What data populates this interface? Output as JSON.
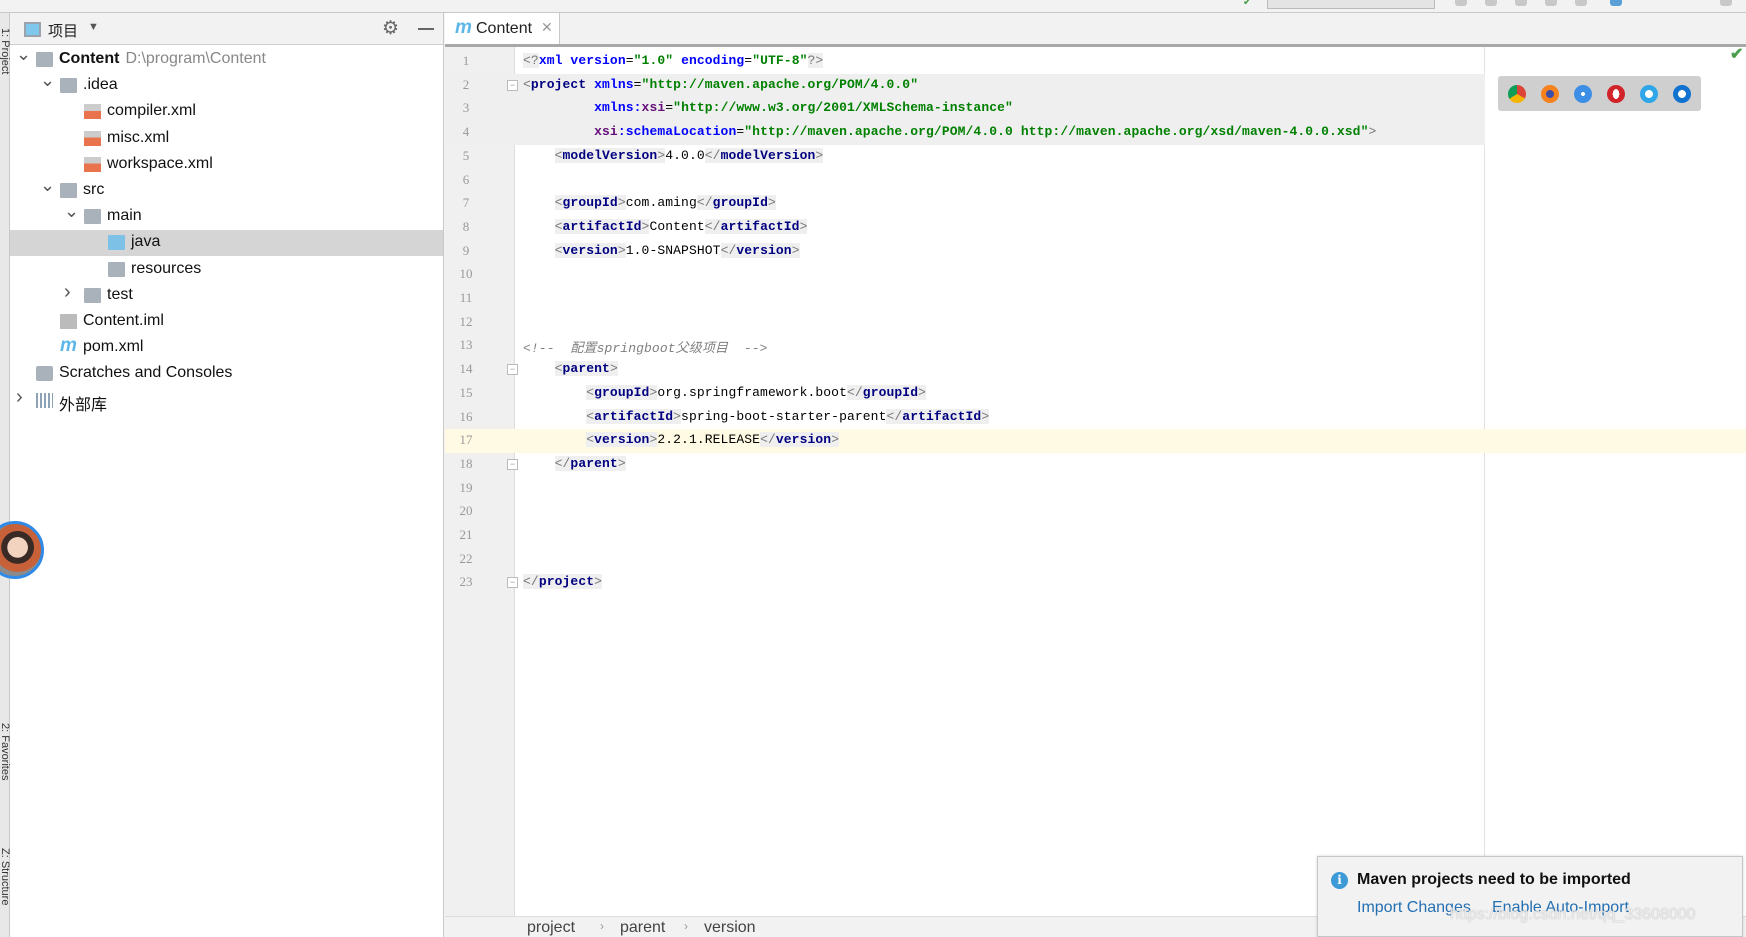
{
  "project_panel": {
    "title": "项目",
    "tree": [
      {
        "label": "Content",
        "path": "D:\\program\\Content",
        "depth": 0,
        "arrow": "down",
        "icon": "module-folder-icon",
        "bold": true
      },
      {
        "label": ".idea",
        "depth": 1,
        "arrow": "down",
        "icon": "folder-icon"
      },
      {
        "label": "compiler.xml",
        "depth": 2,
        "icon": "xml-file-icon"
      },
      {
        "label": "misc.xml",
        "depth": 2,
        "icon": "xml-file-icon"
      },
      {
        "label": "workspace.xml",
        "depth": 2,
        "icon": "xml-file-icon"
      },
      {
        "label": "src",
        "depth": 1,
        "arrow": "down",
        "icon": "folder-icon"
      },
      {
        "label": "main",
        "depth": 2,
        "arrow": "down",
        "icon": "folder-icon"
      },
      {
        "label": "java",
        "depth": 3,
        "icon": "source-folder-icon",
        "selected": true
      },
      {
        "label": "resources",
        "depth": 3,
        "icon": "resources-folder-icon"
      },
      {
        "label": "test",
        "depth": 2,
        "arrow": "right",
        "icon": "folder-icon"
      },
      {
        "label": "Content.iml",
        "depth": 1,
        "icon": "iml-file-icon"
      },
      {
        "label": "pom.xml",
        "depth": 1,
        "icon": "maven-file-icon"
      },
      {
        "label": "Scratches and Consoles",
        "depth": 0,
        "icon": "scratches-icon"
      },
      {
        "label": "外部库",
        "depth": 0,
        "arrow": "right",
        "icon": "library-icon"
      }
    ]
  },
  "side_strip": {
    "project": "1: Project",
    "favorites": "2: Favorites",
    "structure": "Z: Structure"
  },
  "editor": {
    "tab_label": "Content",
    "current_line": 17,
    "lines": [
      [
        [
          "br",
          "<?"
        ],
        [
          "attr",
          "xml "
        ],
        [
          "attr",
          "version"
        ],
        [
          "txt",
          "="
        ],
        [
          "val",
          "\"1.0\""
        ],
        [
          "txt",
          " "
        ],
        [
          "attr",
          "encoding"
        ],
        [
          "txt",
          "="
        ],
        [
          "val",
          "\"UTF-8\""
        ],
        [
          "br",
          "?>"
        ]
      ],
      [
        [
          "br",
          "<"
        ],
        [
          "tag",
          "project "
        ],
        [
          "attr",
          "xmlns"
        ],
        [
          "txt",
          "="
        ],
        [
          "val",
          "\"http://maven.apache.org/POM/4.0.0\""
        ]
      ],
      [
        [
          "txt",
          "         "
        ],
        [
          "attr",
          "xmlns:"
        ],
        [
          "ns",
          "xsi"
        ],
        [
          "txt",
          "="
        ],
        [
          "val",
          "\"http://www.w3.org/2001/XMLSchema-instance\""
        ]
      ],
      [
        [
          "txt",
          "         "
        ],
        [
          "ns",
          "xsi"
        ],
        [
          "attr",
          ":schemaLocation"
        ],
        [
          "txt",
          "="
        ],
        [
          "val",
          "\"http://maven.apache.org/POM/4.0.0 http://maven.apache.org/xsd/maven-4.0.0.xsd\""
        ],
        [
          "br",
          ">"
        ]
      ],
      [
        [
          "txt",
          "    "
        ],
        [
          "br",
          "<"
        ],
        [
          "tag",
          "modelVersion"
        ],
        [
          "br",
          ">"
        ],
        [
          "txt",
          "4.0.0"
        ],
        [
          "br",
          "</"
        ],
        [
          "tag",
          "modelVersion"
        ],
        [
          "br",
          ">"
        ]
      ],
      [],
      [
        [
          "txt",
          "    "
        ],
        [
          "br",
          "<"
        ],
        [
          "tag",
          "groupId"
        ],
        [
          "br",
          ">"
        ],
        [
          "txt",
          "com.aming"
        ],
        [
          "br",
          "</"
        ],
        [
          "tag",
          "groupId"
        ],
        [
          "br",
          ">"
        ]
      ],
      [
        [
          "txt",
          "    "
        ],
        [
          "br",
          "<"
        ],
        [
          "tag",
          "artifactId"
        ],
        [
          "br",
          ">"
        ],
        [
          "txt",
          "Content"
        ],
        [
          "br",
          "</"
        ],
        [
          "tag",
          "artifactId"
        ],
        [
          "br",
          ">"
        ]
      ],
      [
        [
          "txt",
          "    "
        ],
        [
          "br",
          "<"
        ],
        [
          "tag",
          "version"
        ],
        [
          "br",
          ">"
        ],
        [
          "txt",
          "1.0-SNAPSHOT"
        ],
        [
          "br",
          "</"
        ],
        [
          "tag",
          "version"
        ],
        [
          "br",
          ">"
        ]
      ],
      [],
      [],
      [],
      [
        [
          "com",
          "<!--  配置springboot父级项目  -->"
        ]
      ],
      [
        [
          "txt",
          "    "
        ],
        [
          "br",
          "<"
        ],
        [
          "tag",
          "parent"
        ],
        [
          "br",
          ">"
        ]
      ],
      [
        [
          "txt",
          "        "
        ],
        [
          "br",
          "<"
        ],
        [
          "tag",
          "groupId"
        ],
        [
          "br",
          ">"
        ],
        [
          "txt",
          "org.springframework.boot"
        ],
        [
          "br",
          "</"
        ],
        [
          "tag",
          "groupId"
        ],
        [
          "br",
          ">"
        ]
      ],
      [
        [
          "txt",
          "        "
        ],
        [
          "br",
          "<"
        ],
        [
          "tag",
          "artifactId"
        ],
        [
          "br",
          ">"
        ],
        [
          "txt",
          "spring-boot-starter-parent"
        ],
        [
          "br",
          "</"
        ],
        [
          "tag",
          "artifactId"
        ],
        [
          "br",
          ">"
        ]
      ],
      [
        [
          "txt",
          "        "
        ],
        [
          "br",
          "<"
        ],
        [
          "tag",
          "version"
        ],
        [
          "br",
          ">"
        ],
        [
          "txt",
          "2.2.1.RELEASE"
        ],
        [
          "br",
          "</"
        ],
        [
          "tag",
          "version"
        ],
        [
          "br",
          ">"
        ]
      ],
      [
        [
          "txt",
          "    "
        ],
        [
          "br",
          "</"
        ],
        [
          "tag",
          "parent"
        ],
        [
          "br",
          ">"
        ]
      ],
      [],
      [],
      [],
      [],
      [
        [
          "br",
          "</"
        ],
        [
          "tag",
          "project"
        ],
        [
          "br",
          ">"
        ]
      ]
    ],
    "fold_lines": [
      2,
      14,
      18,
      23
    ],
    "browser_icons": [
      "chrome-icon",
      "firefox-icon",
      "safari-icon",
      "opera-icon",
      "internet-explorer-icon",
      "edge-icon"
    ]
  },
  "breadcrumb": [
    "project",
    "parent",
    "version"
  ],
  "notification": {
    "message": "Maven projects need to be imported",
    "import_changes": "Import Changes",
    "enable_auto_import": "Enable Auto-Import"
  },
  "watermark": "https://blog.csdn.net/qq_33608000",
  "colors": {
    "tag": "#000080",
    "attribute": "#0000ff",
    "value": "#008000",
    "namespace": "#660e7a",
    "link": "#2470b3",
    "info": "#3d9ad6"
  }
}
